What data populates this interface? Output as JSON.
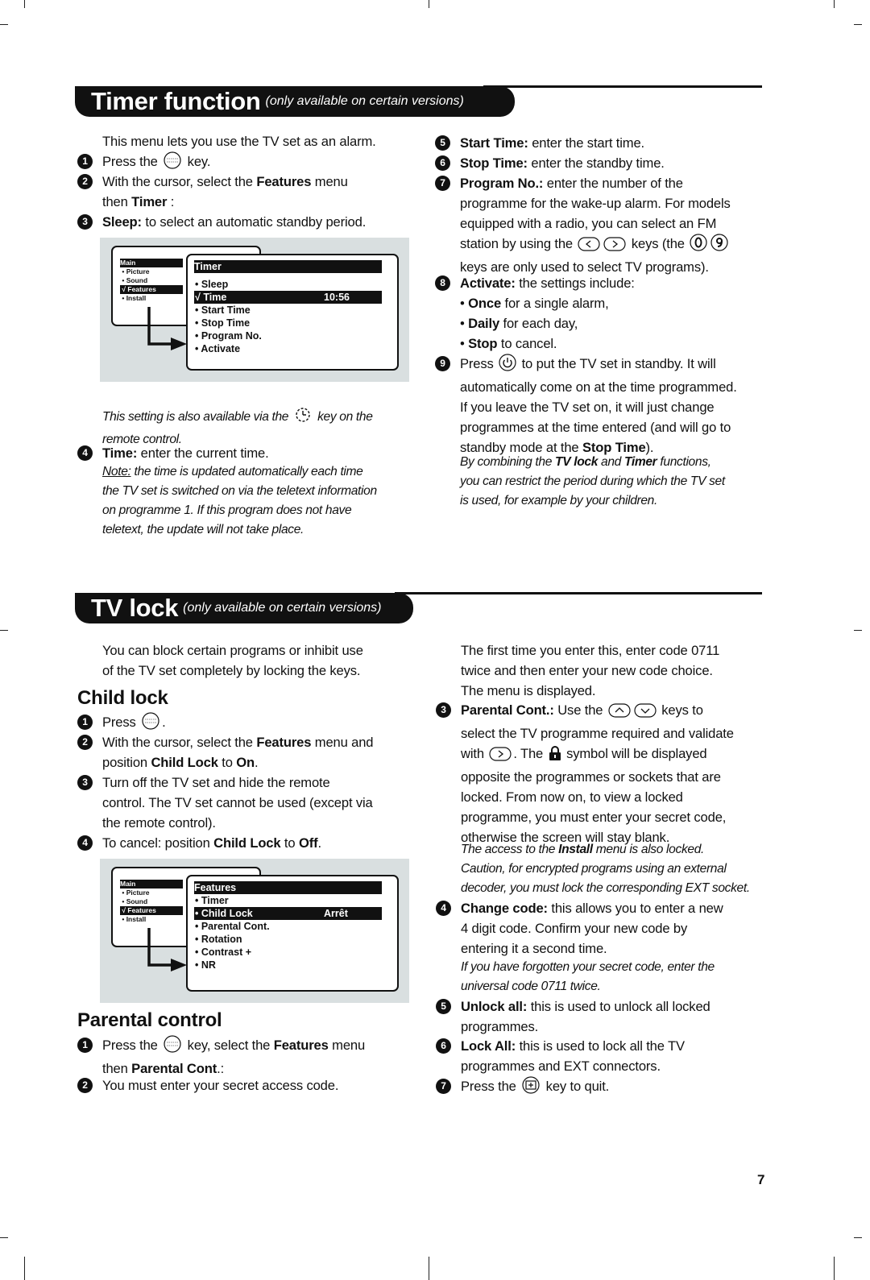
{
  "timer": {
    "title": "Timer function",
    "subtitle": "(only available on certain versions)",
    "left": [
      {
        "runs": [
          [
            "This menu lets you use the TV set as an alarm.",
            ""
          ]
        ]
      },
      {
        "num": "1",
        "runs": [
          [
            "Press the ",
            ""
          ],
          [
            "",
            "icon:menu"
          ],
          [
            " key.",
            ""
          ]
        ]
      },
      {
        "num": "2",
        "runs": [
          [
            "With the cursor, select the ",
            ""
          ],
          [
            "Features",
            "b"
          ],
          [
            " menu\nthen ",
            ""
          ],
          [
            "Timer",
            "b"
          ],
          [
            " :",
            ""
          ]
        ]
      },
      {
        "num": "3",
        "runs": [
          [
            "Sleep:",
            "b"
          ],
          [
            " to select an automatic standby period.",
            ""
          ]
        ]
      },
      {
        "italic": true,
        "runs": [
          [
            "This setting is also available via the ",
            ""
          ],
          [
            "",
            "icon:timer"
          ],
          [
            " key on the\nremote control.",
            ""
          ]
        ]
      },
      {
        "num": "4",
        "runs": [
          [
            "Time:",
            "b"
          ],
          [
            " enter the current time.",
            ""
          ]
        ]
      },
      {
        "italic": true,
        "runs": [
          [
            "Note:",
            "u"
          ],
          [
            " the time is updated automatically each time\nthe TV set is switched on via the teletext information\non programme 1. If this program does not have\nteletext, the update will not take place.",
            ""
          ]
        ]
      }
    ],
    "right": [
      {
        "num": "5",
        "runs": [
          [
            "Start Time:",
            "b"
          ],
          [
            " enter the start time.",
            ""
          ]
        ]
      },
      {
        "num": "6",
        "runs": [
          [
            "Stop Time:",
            "b"
          ],
          [
            " enter the standby time.",
            ""
          ]
        ]
      },
      {
        "num": "7",
        "runs": [
          [
            "Program No.:",
            "b"
          ],
          [
            " enter the number of the\nprogramme for the wake-up alarm. For models\nequipped with a radio, you can select an FM\nstation by using the ",
            ""
          ],
          [
            "",
            "icon:left"
          ],
          [
            "",
            "icon:right"
          ],
          [
            " keys (the ",
            ""
          ],
          [
            "",
            "icon:key0"
          ],
          [
            "",
            "icon:key9"
          ],
          [
            "\nkeys are only used to select TV programs).",
            ""
          ]
        ]
      },
      {
        "num": "8",
        "runs": [
          [
            "Activate:",
            "b"
          ],
          [
            " the settings include:",
            ""
          ]
        ]
      },
      {
        "runs": [
          [
            "• ",
            ""
          ],
          [
            "Once",
            "b"
          ],
          [
            " for a single alarm,",
            ""
          ]
        ]
      },
      {
        "runs": [
          [
            "• ",
            ""
          ],
          [
            "Daily",
            "b"
          ],
          [
            " for each day,",
            ""
          ]
        ]
      },
      {
        "runs": [
          [
            "• ",
            ""
          ],
          [
            "Stop",
            "b"
          ],
          [
            " to cancel.",
            ""
          ]
        ]
      },
      {
        "num": "9",
        "runs": [
          [
            "Press ",
            ""
          ],
          [
            "",
            "icon:power"
          ],
          [
            " to put the TV set in standby. It will\nautomatically come on at the time programmed.\nIf you leave the TV set on, it will just change\nprogrammes at the time entered (and will go to\nstandby mode at the ",
            ""
          ],
          [
            "Stop Time",
            "b"
          ],
          [
            ").",
            ""
          ]
        ]
      },
      {
        "italic": true,
        "runs": [
          [
            "By combining the ",
            ""
          ],
          [
            "TV lock",
            "b"
          ],
          [
            " and ",
            ""
          ],
          [
            "Timer",
            "b"
          ],
          [
            " functions,\nyou can restrict the period during which the TV set\nis used, for example by your children.",
            ""
          ]
        ]
      }
    ],
    "menu": {
      "main_title": "Main",
      "main_items": [
        "• Picture",
        "• Sound",
        "√ Features",
        "• Install"
      ],
      "main_selected": 2,
      "sub_title": "Timer",
      "sub_items": [
        [
          "• Sleep",
          ""
        ],
        [
          "√ Time",
          "10:56"
        ],
        [
          "• Start Time",
          ""
        ],
        [
          "• Stop Time",
          ""
        ],
        [
          "• Program No.",
          ""
        ],
        [
          "• Activate",
          ""
        ]
      ],
      "sub_selected": 1
    }
  },
  "tvlock": {
    "title": "TV lock",
    "subtitle": "(only available on certain versions)",
    "intro": {
      "runs": [
        [
          "You can block certain programs or inhibit use\nof the TV set completely by locking the keys.",
          ""
        ]
      ]
    },
    "child_lock_heading": "Child lock",
    "child_lock": [
      {
        "num": "1",
        "runs": [
          [
            "Press ",
            ""
          ],
          [
            "",
            "icon:menu"
          ],
          [
            ".",
            ""
          ]
        ]
      },
      {
        "num": "2",
        "runs": [
          [
            "With the cursor, select the ",
            ""
          ],
          [
            "Features",
            "b"
          ],
          [
            " menu and\nposition ",
            ""
          ],
          [
            "Child Lock",
            "b"
          ],
          [
            " to ",
            ""
          ],
          [
            "On",
            "b"
          ],
          [
            ".",
            ""
          ]
        ]
      },
      {
        "num": "3",
        "runs": [
          [
            "Turn off the TV set and hide the remote\ncontrol. The TV set cannot be used (except via\nthe remote control).",
            ""
          ]
        ]
      },
      {
        "num": "4",
        "runs": [
          [
            "To cancel: position ",
            ""
          ],
          [
            "Child Lock",
            "b"
          ],
          [
            " to ",
            ""
          ],
          [
            "Off",
            "b"
          ],
          [
            ".",
            ""
          ]
        ]
      }
    ],
    "parental_heading": "Parental control",
    "parental": [
      {
        "num": "1",
        "runs": [
          [
            "Press the ",
            ""
          ],
          [
            "",
            "icon:menu"
          ],
          [
            " key, select the ",
            ""
          ],
          [
            "Features",
            "b"
          ],
          [
            " menu\nthen ",
            ""
          ],
          [
            "Parental Cont",
            "b"
          ],
          [
            ".:",
            ""
          ]
        ]
      },
      {
        "num": "2",
        "runs": [
          [
            "You must enter your secret access code.",
            ""
          ]
        ]
      }
    ],
    "right": [
      {
        "runs": [
          [
            "The first time you enter this, enter code 0711\ntwice and then enter your new code choice.\nThe menu is displayed.",
            ""
          ]
        ]
      },
      {
        "num": "3",
        "runs": [
          [
            "Parental Cont.:",
            "b"
          ],
          [
            " Use the ",
            ""
          ],
          [
            "",
            "icon:up"
          ],
          [
            "",
            "icon:down"
          ],
          [
            " keys to\nselect the TV programme required and validate\nwith ",
            ""
          ],
          [
            "",
            "icon:right"
          ],
          [
            ". The ",
            ""
          ],
          [
            "",
            "icon:lock"
          ],
          [
            " symbol will be displayed\nopposite the programmes or sockets that are\nlocked. From now on, to view a locked\nprogramme, you must enter your secret code,\notherwise the screen will stay blank.",
            ""
          ]
        ]
      },
      {
        "italic": true,
        "runs": [
          [
            "The access to the ",
            ""
          ],
          [
            "Install",
            "b"
          ],
          [
            " menu is also locked.\nCaution, for encrypted programs using an external\ndecoder, you must lock the corresponding EXT socket.",
            ""
          ]
        ]
      },
      {
        "num": "4",
        "runs": [
          [
            "Change code:",
            "b"
          ],
          [
            " this allows you to enter a new\n4 digit code. Confirm your new code by\nentering it a second time.",
            ""
          ]
        ]
      },
      {
        "italic": true,
        "runs": [
          [
            "If you have forgotten your secret code, enter the\nuniversal code 0711 twice.",
            ""
          ]
        ]
      },
      {
        "num": "5",
        "runs": [
          [
            "Unlock all:",
            "b"
          ],
          [
            " this is used to unlock all locked\nprogrammes.",
            ""
          ]
        ]
      },
      {
        "num": "6",
        "runs": [
          [
            "Lock All:",
            "b"
          ],
          [
            " this is used to lock all the TV\nprogrammes and EXT connectors.",
            ""
          ]
        ]
      },
      {
        "num": "7",
        "runs": [
          [
            "Press the ",
            ""
          ],
          [
            "",
            "icon:osd"
          ],
          [
            " key to quit.",
            ""
          ]
        ]
      }
    ],
    "menu": {
      "main_title": "Main",
      "main_items": [
        "• Picture",
        "• Sound",
        "√ Features",
        "• Install"
      ],
      "main_selected": 2,
      "sub_title": "Features",
      "sub_items": [
        [
          "• Timer",
          ""
        ],
        [
          "• Child Lock",
          "Arrêt"
        ],
        [
          "• Parental Cont.",
          ""
        ],
        [
          "• Rotation",
          ""
        ],
        [
          "• Contrast +",
          ""
        ],
        [
          "• NR",
          ""
        ]
      ],
      "sub_selected": 1
    }
  },
  "page_number": "7"
}
